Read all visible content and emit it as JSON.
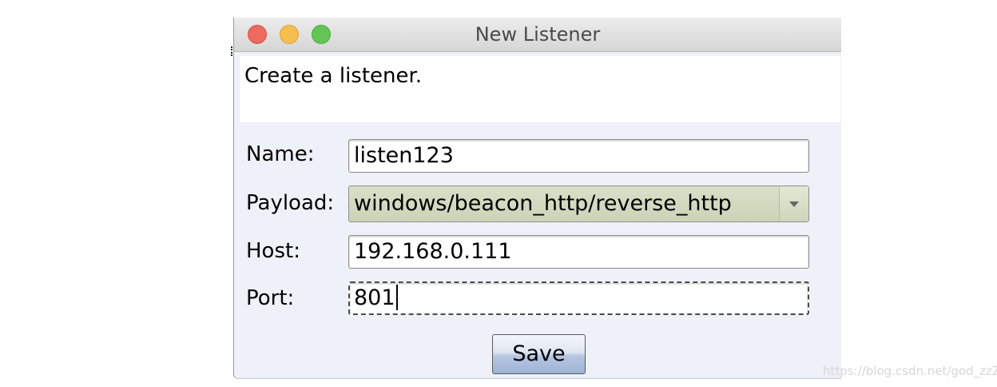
{
  "window": {
    "title": "New Listener"
  },
  "description": "Create a listener.",
  "form": {
    "name_label": "Name:",
    "name_value": "listen123",
    "payload_label": "Payload:",
    "payload_value": "windows/beacon_http/reverse_http",
    "host_label": "Host:",
    "host_value": "192.168.0.111",
    "port_label": "Port:",
    "port_value": "801"
  },
  "buttons": {
    "save_label": "Save"
  },
  "watermark": "https://blog.csdn.net/god_zzZ",
  "colors": {
    "close": "#ed6a5e",
    "minimize": "#f5bf4f",
    "maximize": "#62c554",
    "combo_bg": "#cdd3b8",
    "dialog_bg": "#eef1f8"
  },
  "icons": {
    "close": "close-icon",
    "minimize": "minimize-icon",
    "maximize": "maximize-icon",
    "dropdown": "chevron-down-icon"
  }
}
